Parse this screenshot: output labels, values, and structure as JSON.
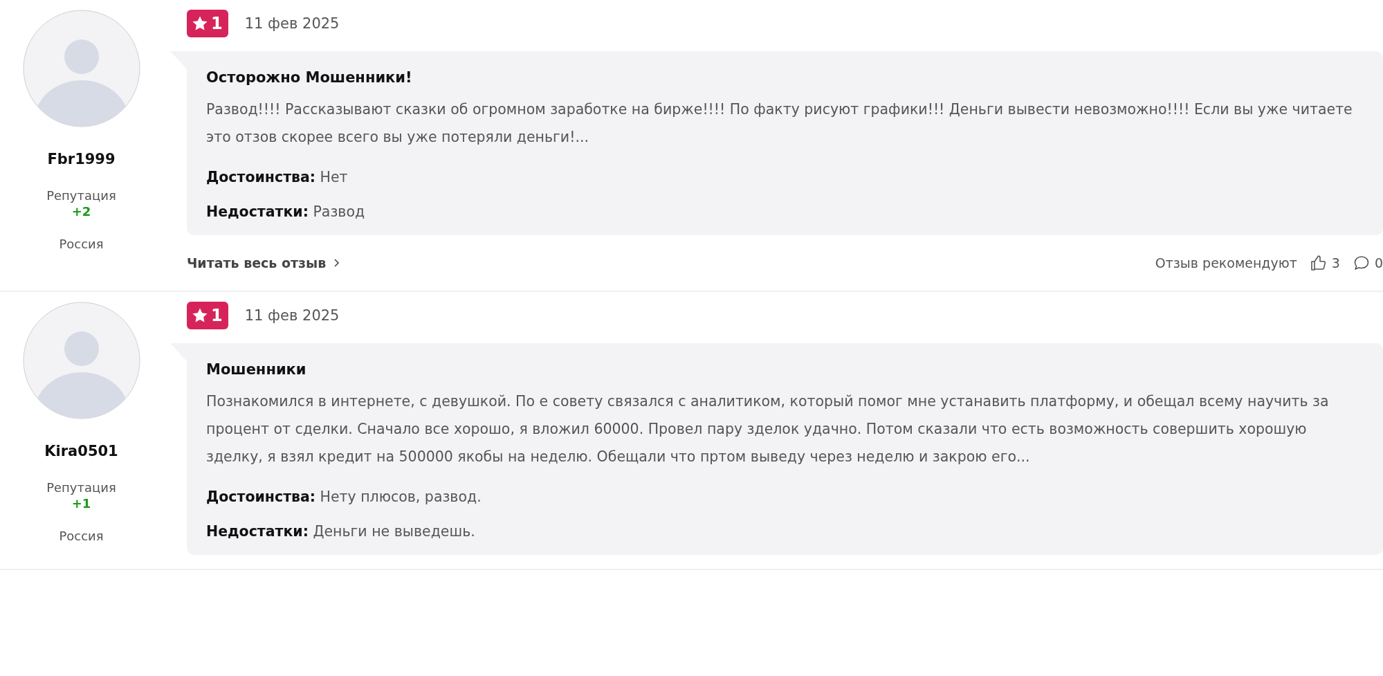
{
  "reviews": [
    {
      "user": {
        "name": "Fbr1999",
        "reputation_label": "Репутация",
        "reputation": "+2",
        "country": "Россия"
      },
      "rating": "1",
      "date": "11 фев 2025",
      "title": "Осторожно Мошенники!",
      "text": "Развод!!!! Рассказывают сказки об огромном заработке на бирже!!!! По факту рисуют графики!!! Деньги вывести невозможно!!!! Если вы уже читаете это отзов скорее всего вы уже потеряли деньги!...",
      "pros_label": "Достоинства:",
      "pros": "Нет",
      "cons_label": "Недостатки:",
      "cons": "Развод",
      "footer": {
        "read_more": "Читать весь отзыв",
        "recommend_label": "Отзыв рекомендуют",
        "likes": "3",
        "comments": "0"
      }
    },
    {
      "user": {
        "name": "Kira0501",
        "reputation_label": "Репутация",
        "reputation": "+1",
        "country": "Россия"
      },
      "rating": "1",
      "date": "11 фев 2025",
      "title": "Мошенники",
      "text": "Познакомился в интернете, с девушкой. По е совету связался с аналитиком, который помог мне устанавить платформу, и обещал всему научить за процент от сделки. Сначало все хорошо, я вложил 60000. Провел пару зделок удачно. Потом сказали что есть возможность совершить хорошую зделку, я взял кредит на 500000 якобы на неделю. Обещали что пртом выведу через неделю и закрою его...",
      "pros_label": "Достоинства:",
      "pros": "Нету плюсов, развод.",
      "cons_label": "Недостатки:",
      "cons": "Деньги не выведешь."
    }
  ]
}
